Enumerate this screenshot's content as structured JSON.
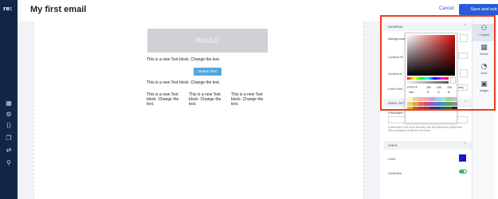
{
  "sidenav": {
    "logo": "re:",
    "icons": [
      "layout-grid-icon",
      "settings-icon",
      "code-brackets-icon",
      "copy-pages-icon",
      "share-arrows-icon",
      "pin-icon"
    ]
  },
  "header": {
    "title": "My first email",
    "cancel_label": "Cancel",
    "save_label": "Save and exit"
  },
  "email": {
    "image_label": "IMAGE",
    "text_1": "This is a new Text block. Change the text.",
    "button_label": "Button Text",
    "text_2": "This is a new Text block. Change the text.",
    "columns": [
      "This is a new Text block. Change the text.",
      "This is a new Text block. Change the text.",
      "This is a new Text block. Change the text."
    ]
  },
  "panel": {
    "general_title": "GENERAL",
    "background_label": "Background",
    "content_w_label": "Content W",
    "content_a_label": "Content A",
    "font_fam_label": "Font Fami",
    "font_fam_value": "ans)",
    "email_settings_title": "EMAIL SET",
    "preheader_label": "Preheader Text",
    "preheader_help": "A preheader is the short summary text that follows the subject line when viewing an email from the inbox.",
    "links_title": "LINKS",
    "color_label": "Color",
    "color_value": "#1a14d6",
    "underline_label": "Underline",
    "underline_on": true,
    "accent": "#ef3b23"
  },
  "picker": {
    "hex": "FFFFFF",
    "r": "255",
    "g": "255",
    "b": "255",
    "hex_label": "Hex",
    "r_label": "R",
    "g_label": "G",
    "b_label": "B",
    "swatches": [
      "#f8f5c8",
      "#e8d0a9",
      "#f6b6a0",
      "#f9a8b0",
      "#caa4d8",
      "#aac9f2",
      "#a4e0d7",
      "#9ad39b",
      "#c5c5c5",
      "#efcf74",
      "#e6a04a",
      "#e7685b",
      "#d2536d",
      "#8a62b9",
      "#4f7fd0",
      "#3f9fa0",
      "#5aa25c",
      "#8e8e8e",
      "#e6b700",
      "#b86b16",
      "#b63a2d",
      "#9d2e4d",
      "#4a2a7a",
      "#213c8c",
      "#1d5f5f",
      "#2b6b31",
      "#262626"
    ]
  },
  "rail": [
    {
      "icon": "content-icon",
      "glyph": "⚇",
      "label": "Content"
    },
    {
      "icon": "blocks-icon",
      "glyph": "▦",
      "label": "Blocks"
    },
    {
      "icon": "body-icon",
      "glyph": "◔",
      "label": "Body"
    },
    {
      "icon": "images-icon",
      "glyph": "▣",
      "label": "Images"
    }
  ]
}
